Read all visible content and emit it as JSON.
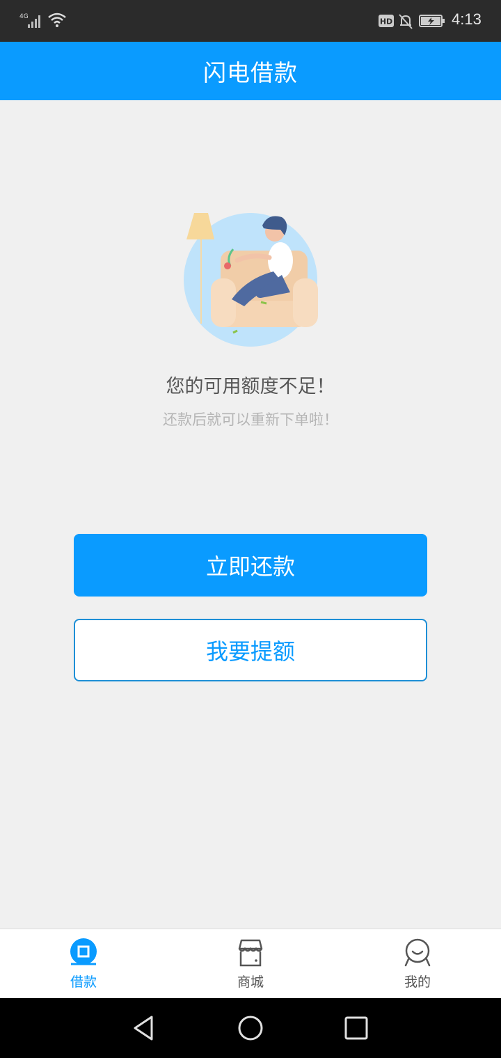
{
  "status_bar": {
    "network": "4G",
    "time": "4:13",
    "hd_badge": "HD",
    "icons": [
      "signal-icon",
      "wifi-icon",
      "hd-icon",
      "mute-bell-icon",
      "battery-charging-icon"
    ]
  },
  "header": {
    "title": "闪电借款"
  },
  "illustration": {
    "icon": "person-on-sofa-illustration"
  },
  "message": {
    "title": "您的可用额度不足！",
    "subtitle": "还款后就可以重新下单啦！"
  },
  "buttons": {
    "repay_label": "立即还款",
    "raise_limit_label": "我要提额"
  },
  "bottom_nav": {
    "items": [
      {
        "label": "借款",
        "icon": "loan-icon",
        "active": true
      },
      {
        "label": "商城",
        "icon": "store-icon",
        "active": false
      },
      {
        "label": "我的",
        "icon": "profile-icon",
        "active": false
      }
    ]
  },
  "system_nav": {
    "icons": [
      "back-icon",
      "home-icon",
      "recents-icon"
    ]
  },
  "colors": {
    "accent": "#0a9bff",
    "status_bar": "#2b2b2b",
    "background": "#f0f0f0",
    "system_nav": "#000000"
  }
}
